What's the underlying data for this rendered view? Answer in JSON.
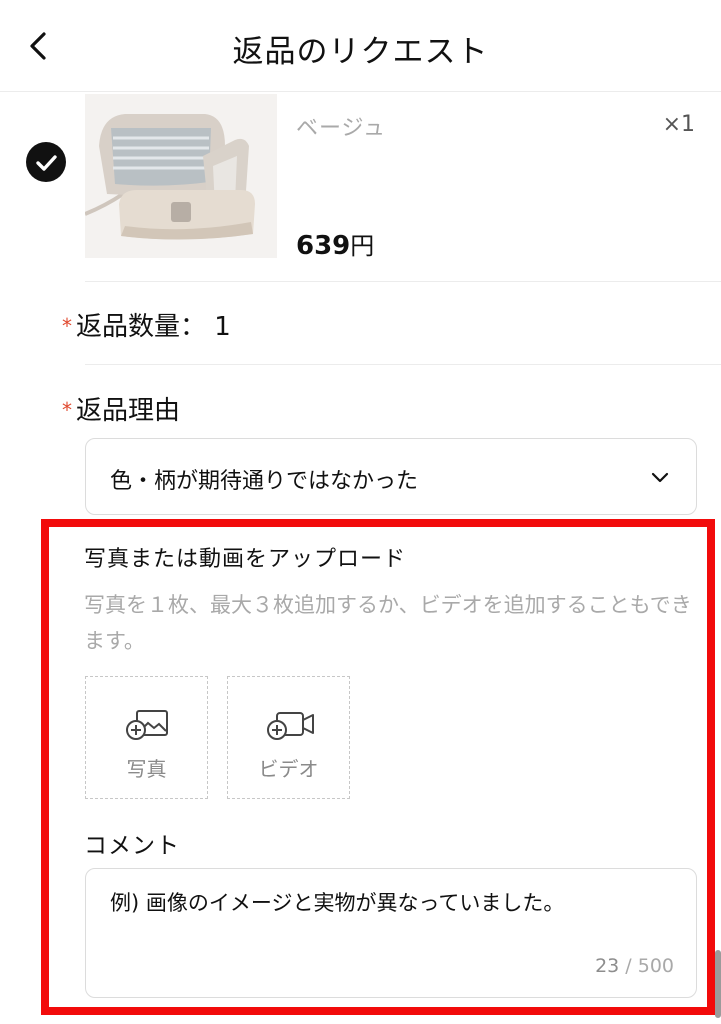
{
  "header": {
    "title": "返品のリクエスト",
    "back_icon": "chevron-left-icon"
  },
  "product": {
    "selected": true,
    "variant": "ベージュ",
    "quantity": "×1",
    "price_value": "639",
    "price_unit": "円"
  },
  "return_quantity": {
    "required_mark": "*",
    "label": "返品数量：",
    "value": "1"
  },
  "return_reason": {
    "required_mark": "*",
    "label": "返品理由",
    "selected": "色・柄が期待通りではなかった"
  },
  "upload": {
    "title": "写真または動画をアップロード",
    "description": "写真を１枚、最大３枚追加するか、ビデオを追加することもできます。",
    "photo_label": "写真",
    "video_label": "ビデオ"
  },
  "comment": {
    "label": "コメント",
    "value": "例) 画像のイメージと実物が異なっていました。",
    "count": "23",
    "separator": " / ",
    "max": "500"
  },
  "colors": {
    "highlight": "#f20b0b",
    "required": "#e0492f",
    "muted": "#a9a9a9"
  }
}
